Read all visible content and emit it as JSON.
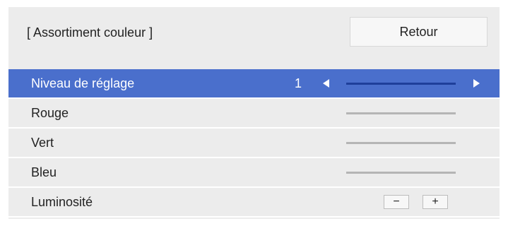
{
  "header": {
    "title": "[ Assortiment couleur ]",
    "back_label": "Retour"
  },
  "rows": [
    {
      "label": "Niveau de réglage",
      "value": "1",
      "selected": true
    },
    {
      "label": "Rouge"
    },
    {
      "label": "Vert"
    },
    {
      "label": "Bleu"
    },
    {
      "label": "Luminosité"
    }
  ],
  "controls": {
    "minus_label": "−",
    "plus_label": "+",
    "left_arrow_icon": "arrow-left-icon",
    "right_arrow_icon": "arrow-right-icon"
  },
  "colors": {
    "selected_row": "#4a6fcc",
    "panel_background": "#ececec",
    "slider_track_selected": "#1f3f9a",
    "slider_track": "#b5b5b5"
  }
}
